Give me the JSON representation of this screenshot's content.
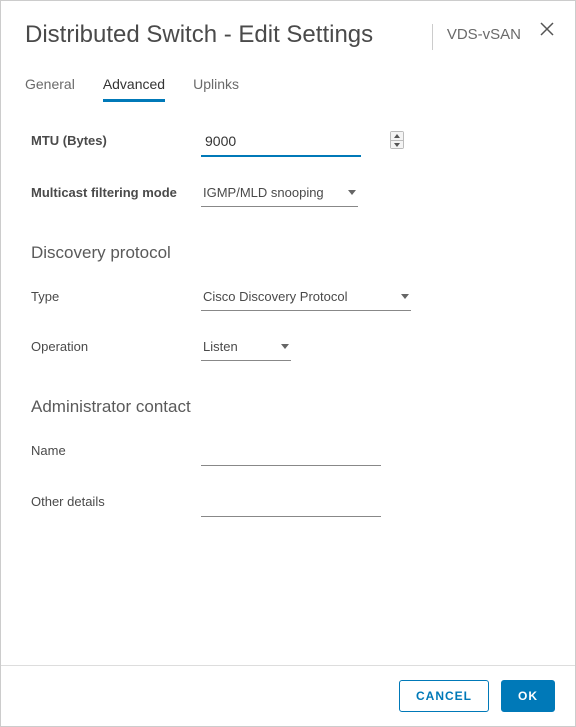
{
  "header": {
    "title": "Distributed Switch - Edit Settings",
    "context": "VDS-vSAN"
  },
  "tabs": [
    {
      "label": "General",
      "active": false
    },
    {
      "label": "Advanced",
      "active": true
    },
    {
      "label": "Uplinks",
      "active": false
    }
  ],
  "form": {
    "mtu": {
      "label": "MTU (Bytes)",
      "value": "9000"
    },
    "multicast": {
      "label": "Multicast filtering mode",
      "value": "IGMP/MLD snooping"
    }
  },
  "discovery": {
    "section": "Discovery protocol",
    "type": {
      "label": "Type",
      "value": "Cisco Discovery Protocol"
    },
    "operation": {
      "label": "Operation",
      "value": "Listen"
    }
  },
  "admin": {
    "section": "Administrator contact",
    "name": {
      "label": "Name",
      "value": ""
    },
    "other": {
      "label": "Other details",
      "value": ""
    }
  },
  "footer": {
    "cancel": "CANCEL",
    "ok": "OK"
  }
}
